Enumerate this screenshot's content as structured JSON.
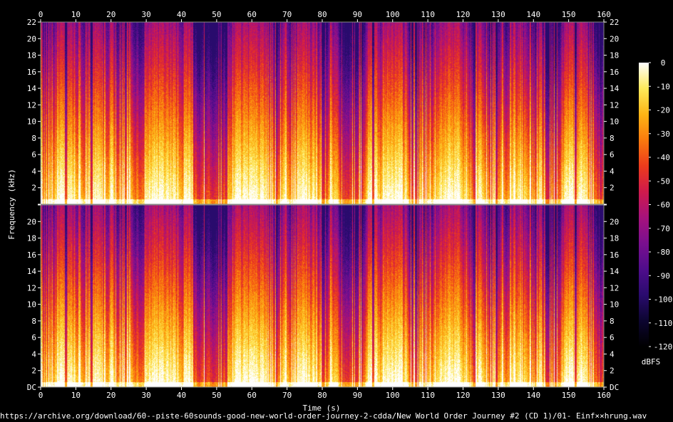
{
  "chart_data": {
    "type": "heatmap",
    "title": "",
    "xlabel": "Time (s)",
    "ylabel": "Frequency (kHz)",
    "xlim": [
      0,
      160
    ],
    "x_ticks": [
      0,
      10,
      20,
      30,
      40,
      50,
      60,
      70,
      80,
      90,
      100,
      110,
      120,
      130,
      140,
      150,
      160
    ],
    "ylim": [
      0,
      22
    ],
    "y_ticks": [
      0,
      2,
      4,
      6,
      8,
      10,
      12,
      14,
      16,
      18,
      20,
      22
    ],
    "y_tick_labels": [
      "DC",
      "2",
      "4",
      "6",
      "8",
      "10",
      "12",
      "14",
      "16",
      "18",
      "20",
      "22"
    ],
    "channels": 2,
    "colorbar": {
      "label": "dBFS",
      "range": [
        -120,
        0
      ],
      "ticks": [
        0,
        -10,
        -20,
        -30,
        -40,
        -50,
        -60,
        -70,
        -80,
        -90,
        -100,
        -110,
        -120
      ],
      "tick_labels": [
        "0",
        "-10",
        "-20",
        "-30",
        "-40",
        "-50",
        "-60",
        "-70",
        "-80",
        "-90",
        "-100",
        "-110",
        "-120"
      ],
      "colors": [
        "#000000",
        "#0c0530",
        "#2a0b6e",
        "#4f0d8c",
        "#7a0f8f",
        "#a6127c",
        "#cf1a4c",
        "#ec3b1c",
        "#fa7a0e",
        "#fdb515",
        "#fde95a",
        "#ffffff"
      ]
    },
    "grid": false
  },
  "source_path": "https://archive.org/download/60--piste-60sounds-good-new-world-order-journey-2-cdda/New World Order Journey #2 (CD 1)/01- Einf××hrung.wav"
}
